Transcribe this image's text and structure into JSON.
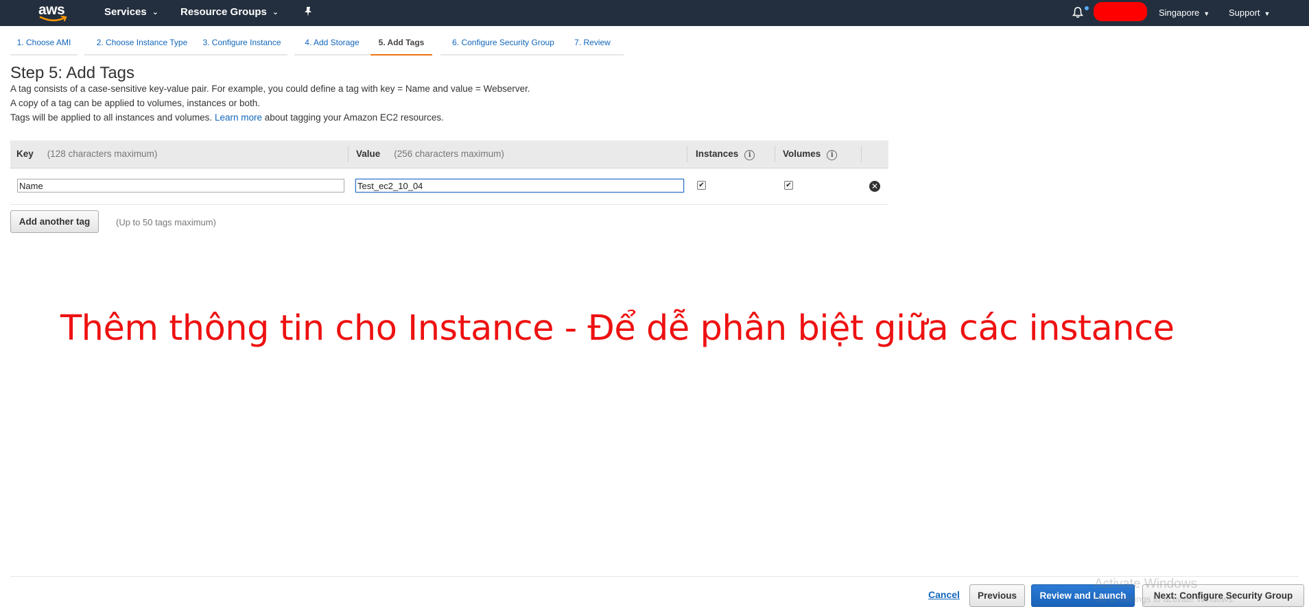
{
  "topnav": {
    "logo": "aws",
    "services": "Services",
    "resource_groups": "Resource Groups",
    "region": "Singapore",
    "support": "Support",
    "icons": [
      "pin-icon",
      "bell-icon",
      "chevron-down-icon"
    ]
  },
  "steps": [
    {
      "label": "1. Choose AMI",
      "active": false
    },
    {
      "label": "2. Choose Instance Type",
      "active": false
    },
    {
      "label": "3. Configure Instance",
      "active": false
    },
    {
      "label": "4. Add Storage",
      "active": false
    },
    {
      "label": "5. Add Tags",
      "active": true
    },
    {
      "label": "6. Configure Security Group",
      "active": false
    },
    {
      "label": "7. Review",
      "active": false
    }
  ],
  "page": {
    "title": "Step 5: Add Tags",
    "line1": "A tag consists of a case-sensitive key-value pair. For example, you could define a tag with key = Name and value = Webserver.",
    "line2": "A copy of a tag can be applied to volumes, instances or both.",
    "line3_before": "Tags will be applied to all instances and volumes.",
    "line3_link": "Learn more",
    "line3_after": "about tagging your Amazon EC2 resources."
  },
  "table": {
    "headers": {
      "key": "Key",
      "key_hint": "(128 characters maximum)",
      "value": "Value",
      "value_hint": "(256 characters maximum)",
      "instances": "Instances",
      "volumes": "Volumes"
    },
    "rows": [
      {
        "key": "Name",
        "value": "Test_ec2_10_04",
        "instances": true,
        "volumes": true
      }
    ]
  },
  "add_tag": {
    "label": "Add another tag",
    "hint": "(Up to 50 tags maximum)"
  },
  "annotation": "Thêm thông tin cho Instance  - Để dễ phân biệt giữa các instance",
  "footer": {
    "cancel": "Cancel",
    "previous": "Previous",
    "review": "Review and Launch",
    "next": "Next: Configure Security Group"
  },
  "watermark": {
    "line1": "Activate Windows",
    "line2": "Go to Settings to activate Windows."
  },
  "colors": {
    "nav_bg": "#232f3e",
    "link": "#1166bb",
    "active_step": "#ec7211",
    "primary_button": "#1a62b8",
    "annotation": "#ee1111"
  }
}
